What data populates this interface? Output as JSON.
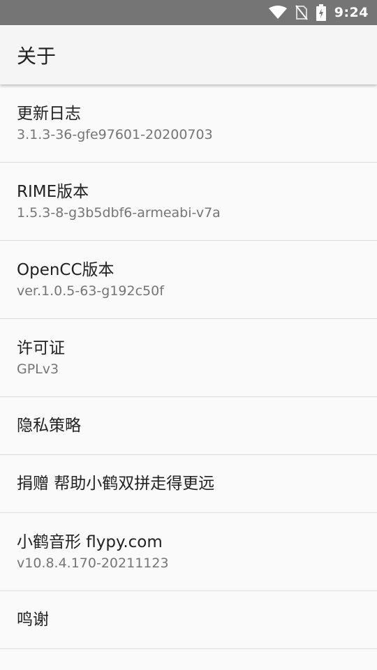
{
  "status_bar": {
    "time": "9:24",
    "icons": [
      "wifi-icon",
      "no-sim-icon",
      "battery-charging-icon"
    ]
  },
  "app_bar": {
    "title": "关于"
  },
  "items": [
    {
      "title": "更新日志",
      "summary": "3.1.3-36-gfe97601-20200703"
    },
    {
      "title": "RIME版本",
      "summary": "1.5.3-8-g3b5dbf6-armeabi-v7a"
    },
    {
      "title": "OpenCC版本",
      "summary": "ver.1.0.5-63-g192c50f"
    },
    {
      "title": "许可证",
      "summary": "GPLv3"
    },
    {
      "title": "隐私策略"
    },
    {
      "title": "捐赠 帮助小鹤双拼走得更远"
    },
    {
      "title": "小鹤音形 flypy.com",
      "summary": "v10.8.4.170-20211123"
    },
    {
      "title": "鸣谢"
    }
  ]
}
